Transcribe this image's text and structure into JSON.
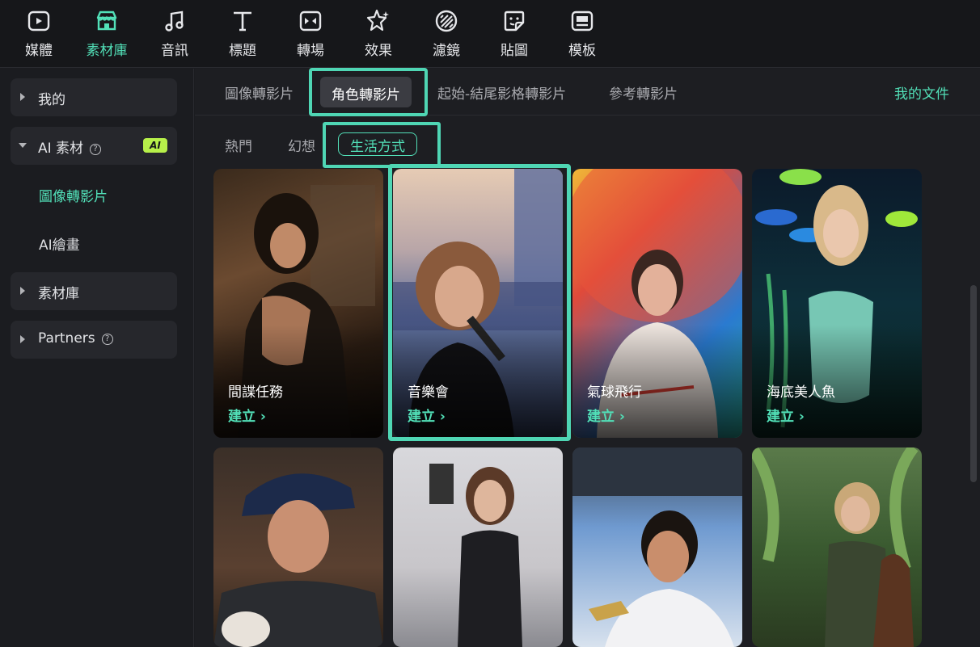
{
  "toolbar": {
    "items": [
      {
        "label": "媒體",
        "icon": "media-icon"
      },
      {
        "label": "素材庫",
        "icon": "store-icon"
      },
      {
        "label": "音訊",
        "icon": "music-note-icon"
      },
      {
        "label": "標題",
        "icon": "text-title-icon"
      },
      {
        "label": "轉場",
        "icon": "transition-icon"
      },
      {
        "label": "效果",
        "icon": "effects-icon"
      },
      {
        "label": "濾鏡",
        "icon": "filter-icon"
      },
      {
        "label": "貼圖",
        "icon": "sticker-icon"
      },
      {
        "label": "模板",
        "icon": "template-icon"
      }
    ],
    "active_index": 1
  },
  "sidebar": {
    "mine": "我的",
    "ai_materials": "AI 素材",
    "ai_badge": "AI",
    "sub_items": [
      "圖像轉影片",
      "AI繪畫"
    ],
    "library": "素材庫",
    "partners": "Partners"
  },
  "tabs": {
    "items": [
      "圖像轉影片",
      "角色轉影片",
      "起始-結尾影格轉影片",
      "參考轉影片"
    ],
    "active": "角色轉影片",
    "my_docs": "我的文件"
  },
  "filters": {
    "items": [
      "熱門",
      "幻想",
      "生活方式"
    ],
    "active": "生活方式"
  },
  "cards": [
    {
      "title": "間諜任務",
      "create": "建立 ›"
    },
    {
      "title": "音樂會",
      "create": "建立 ›"
    },
    {
      "title": "氣球飛行",
      "create": "建立 ›"
    },
    {
      "title": "海底美人魚",
      "create": "建立 ›"
    }
  ],
  "colors": {
    "accent": "#52e0b8",
    "highlight": "#4fd6b4",
    "ai_badge": "#b7f04a"
  }
}
